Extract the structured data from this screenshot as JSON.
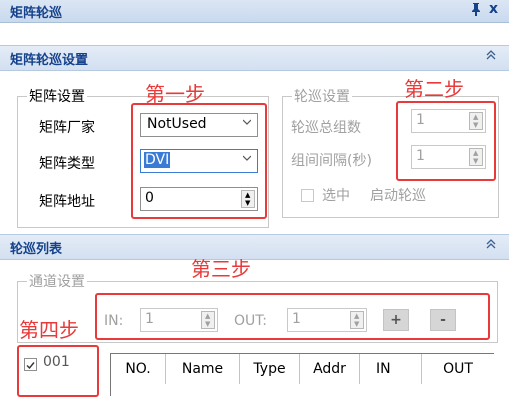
{
  "window": {
    "title": "矩阵轮巡",
    "pin_glyph": "ꟼ",
    "close_glyph": "x"
  },
  "matrix_settings_section": {
    "title": "矩阵轮巡设置",
    "collapse_glyph": "≈"
  },
  "matrix_group": {
    "legend": "矩阵设置",
    "vendor_label": "矩阵厂家",
    "vendor_value": "NotUsed",
    "type_label": "矩阵类型",
    "type_value": "DVI",
    "address_label": "矩阵地址",
    "address_value": "0"
  },
  "patrol_group": {
    "legend": "轮巡设置",
    "total_groups_label": "轮巡总组数",
    "total_groups_value": "1",
    "interval_label": "组间间隔(秒)",
    "interval_value": "1",
    "select_label": "选中",
    "enable_label": "启动轮巡"
  },
  "patrol_list_section": {
    "title": "轮巡列表",
    "collapse_glyph": "≈"
  },
  "channel_group": {
    "legend": "通道设置",
    "in_label": "IN:",
    "in_value": "1",
    "out_label": "OUT:",
    "out_value": "1",
    "add_label": "+",
    "remove_label": "-"
  },
  "list_item": {
    "label": "001",
    "checked": true
  },
  "table": {
    "columns": [
      "NO.",
      "Name",
      "Type",
      "Addr",
      "IN",
      "OUT"
    ]
  },
  "annotations": {
    "step1": "第一步",
    "step2": "第二步",
    "step3": "第三步",
    "step4": "第四步",
    "color": "#e83a3a"
  }
}
